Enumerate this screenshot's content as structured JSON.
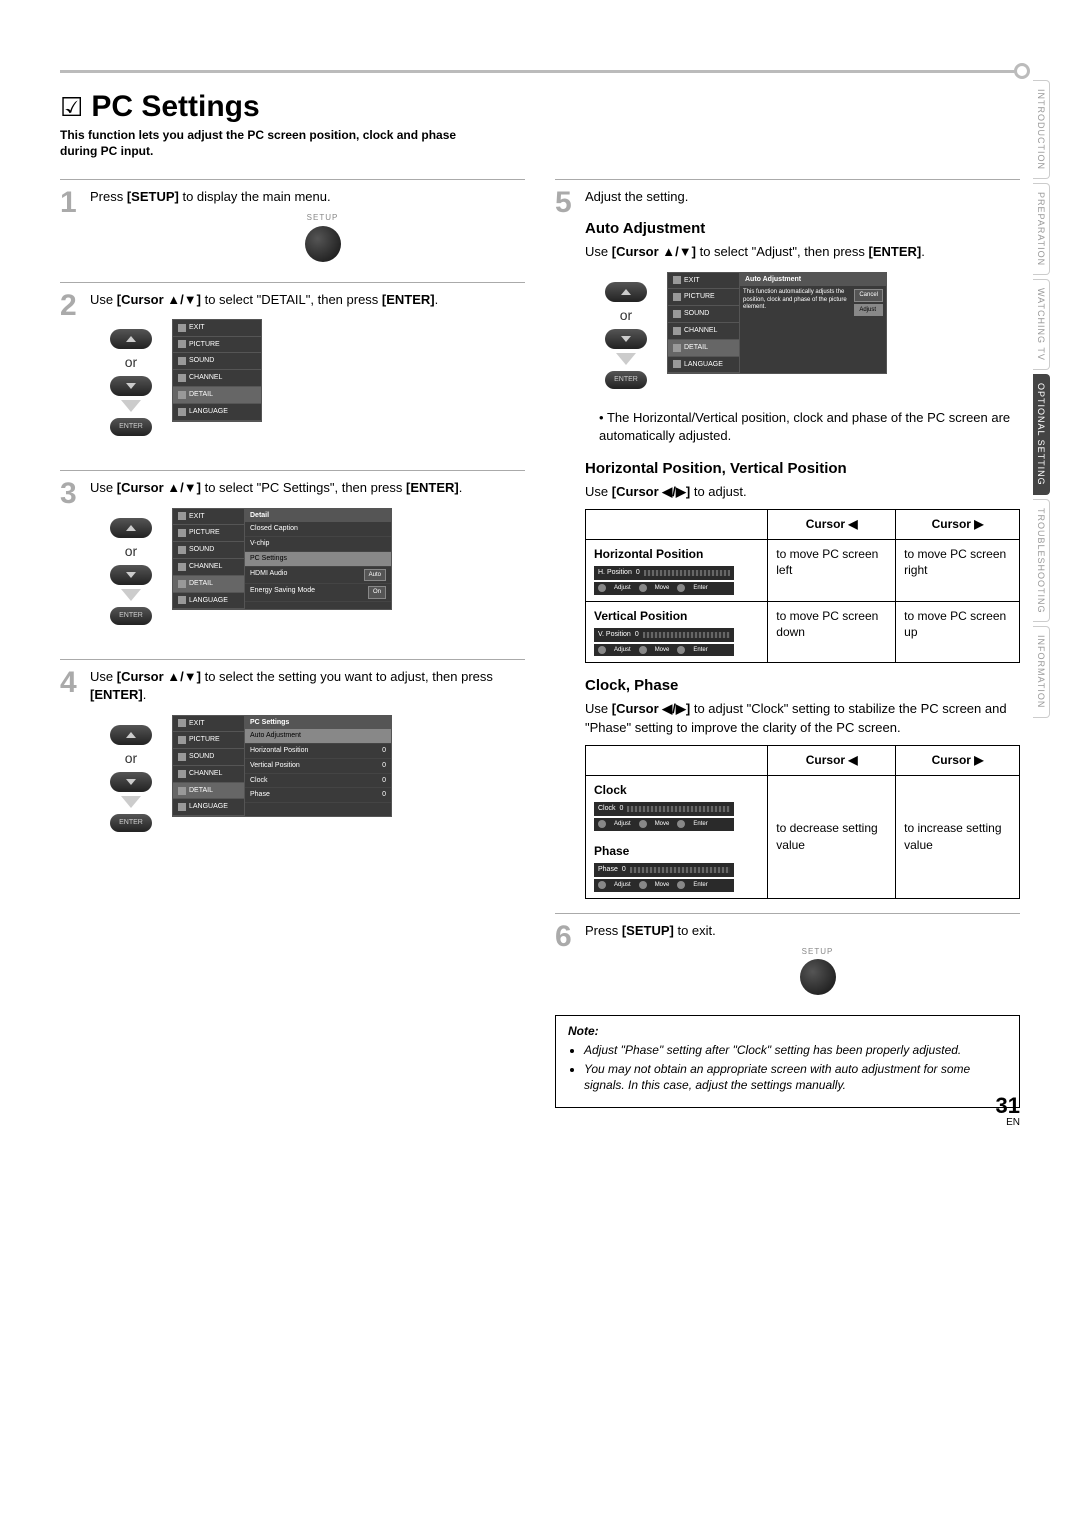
{
  "title": "PC Settings",
  "intro": "This function lets you adjust the PC screen position, clock and phase during PC input.",
  "side_tabs": [
    "INTRODUCTION",
    "PREPARATION",
    "WATCHING TV",
    "OPTIONAL SETTING",
    "TROUBLESHOOTING",
    "INFORMATION"
  ],
  "active_tab": "OPTIONAL SETTING",
  "steps": {
    "s1": {
      "num": "1",
      "text_pre": "Press ",
      "bold": "[SETUP]",
      "text_post": " to display the main menu."
    },
    "s2": {
      "num": "2",
      "text_pre": "Use ",
      "bold": "[Cursor ▲/▼]",
      "text_mid": " to select \"DETAIL\", then press ",
      "bold2": "[ENTER]",
      "text_post": "."
    },
    "s3": {
      "num": "3",
      "text_pre": "Use ",
      "bold": "[Cursor ▲/▼]",
      "text_mid": " to select \"PC Settings\", then press ",
      "bold2": "[ENTER]",
      "text_post": "."
    },
    "s4": {
      "num": "4",
      "text_pre": "Use ",
      "bold": "[Cursor ▲/▼]",
      "text_mid": " to select the setting you want to adjust, then press ",
      "bold2": "[ENTER]",
      "text_post": "."
    },
    "s5": {
      "num": "5",
      "text": "Adjust the setting."
    },
    "s6": {
      "num": "6",
      "text_pre": "Press ",
      "bold": "[SETUP]",
      "text_post": " to exit."
    }
  },
  "labels": {
    "setup": "SETUP",
    "enter": "ENTER",
    "or": "or"
  },
  "osd_menu": {
    "exit": "EXIT",
    "items": [
      "PICTURE",
      "SOUND",
      "CHANNEL",
      "DETAIL",
      "LANGUAGE"
    ]
  },
  "osd_detail": {
    "header": "Detail",
    "rows": [
      {
        "label": "Closed Caption",
        "val": ""
      },
      {
        "label": "V-chip",
        "val": ""
      },
      {
        "label": "PC Settings",
        "val": "",
        "hl": true
      },
      {
        "label": "HDMI Audio",
        "val": "Auto"
      },
      {
        "label": "Energy Saving Mode",
        "val": "On"
      }
    ]
  },
  "osd_pcsettings": {
    "header": "PC Settings",
    "rows": [
      {
        "label": "Auto Adjustment",
        "val": "",
        "hl": true
      },
      {
        "label": "Horizontal Position",
        "val": "0"
      },
      {
        "label": "Vertical Position",
        "val": "0"
      },
      {
        "label": "Clock",
        "val": "0"
      },
      {
        "label": "Phase",
        "val": "0"
      }
    ]
  },
  "osd_auto": {
    "header": "Auto Adjustment",
    "desc": "This function automatically adjusts the position, clock and phase of the picture element.",
    "cancel": "Cancel",
    "adjust": "Adjust"
  },
  "sec_auto": {
    "title": "Auto Adjustment",
    "instr_pre": "Use ",
    "instr_bold": "[Cursor ▲/▼]",
    "instr_mid": " to select \"Adjust\", then press ",
    "instr_bold2": "[ENTER]",
    "instr_post": ".",
    "bullet": "The Horizontal/Vertical position, clock and phase of the PC screen are automatically adjusted."
  },
  "sec_pos": {
    "title": "Horizontal Position, Vertical Position",
    "instr_pre": "Use ",
    "instr_bold": "[Cursor ◀/▶]",
    "instr_post": " to adjust.",
    "table": {
      "h_left": "Cursor ◀",
      "h_right": "Cursor ▶",
      "row1_label": "Horizontal Position",
      "row1_slider": "H. Position",
      "row1_left": "to move PC screen left",
      "row1_right": "to move PC screen right",
      "row2_label": "Vertical Position",
      "row2_slider": "V. Position",
      "row2_left": "to move PC screen down",
      "row2_right": "to move PC screen up"
    }
  },
  "sec_clock": {
    "title": "Clock, Phase",
    "instr_pre": "Use ",
    "instr_bold": "[Cursor ◀/▶]",
    "instr_post": " to adjust \"Clock\" setting to stabilize the PC screen and \"Phase\" setting to improve the clarity of the PC screen.",
    "table": {
      "h_left": "Cursor ◀",
      "h_right": "Cursor ▶",
      "row1_label": "Clock",
      "row1_slider": "Clock",
      "row2_label": "Phase",
      "row2_slider": "Phase",
      "left_text": "to decrease setting value",
      "right_text": "to increase setting value"
    }
  },
  "slider_ctrl": {
    "adjust": "Adjust",
    "move": "Move",
    "enter": "Enter",
    "val": "0"
  },
  "note": {
    "title": "Note:",
    "items": [
      "Adjust \"Phase\" setting after \"Clock\" setting has been properly adjusted.",
      "You may not obtain an appropriate screen with auto adjustment for some signals. In this case, adjust the settings manually."
    ]
  },
  "page": {
    "num": "31",
    "lang": "EN"
  }
}
